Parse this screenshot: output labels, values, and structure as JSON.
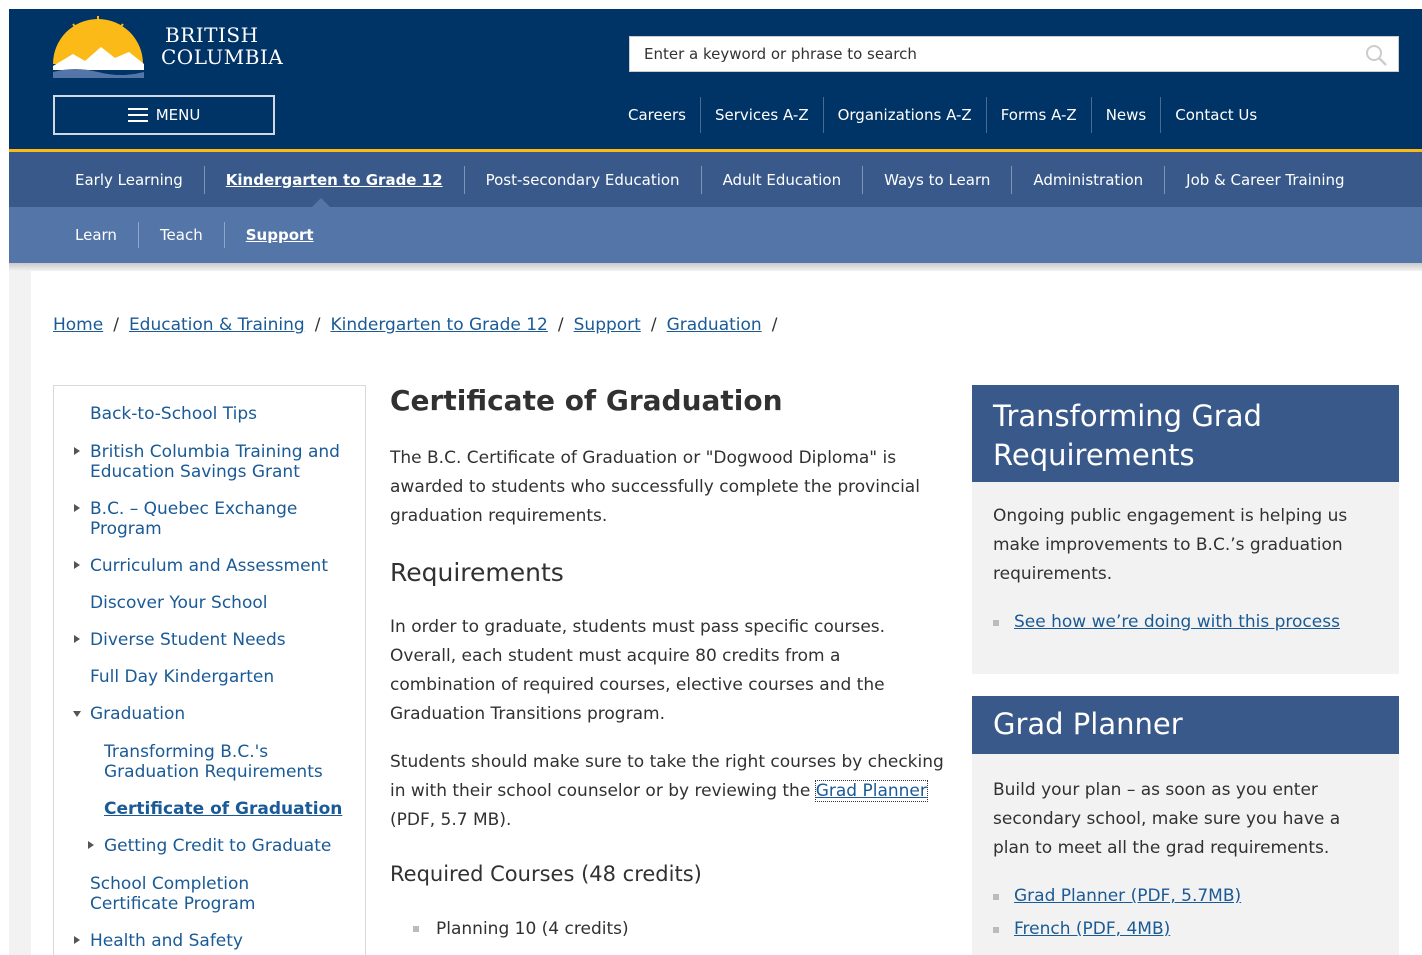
{
  "header": {
    "logo_line1": "BRITISH",
    "logo_line2": "COLUMBIA",
    "search_placeholder": "Enter a keyword or phrase to search",
    "menu_label": "MENU",
    "top_links": [
      "Careers",
      "Services A-Z",
      "Organizations A-Z",
      "Forms A-Z",
      "News",
      "Contact Us"
    ]
  },
  "nav_primary": [
    "Early Learning",
    "Kindergarten to Grade 12",
    "Post-secondary Education",
    "Adult Education",
    "Ways to Learn",
    "Administration",
    "Job & Career Training"
  ],
  "nav_primary_active": "Kindergarten to Grade 12",
  "nav_secondary": [
    "Learn",
    "Teach",
    "Support"
  ],
  "nav_secondary_active": "Support",
  "breadcrumb": [
    "Home",
    "Education & Training",
    "Kindergarten to Grade 12",
    "Support",
    "Graduation"
  ],
  "sidebar": {
    "items": [
      {
        "label": "Back-to-School Tips",
        "expandable": false
      },
      {
        "label": "British Columbia Training and Education Savings Grant",
        "expandable": true
      },
      {
        "label": "B.C. – Quebec Exchange Program",
        "expandable": true
      },
      {
        "label": "Curriculum and Assessment",
        "expandable": true
      },
      {
        "label": "Discover Your School",
        "expandable": false
      },
      {
        "label": "Diverse Student Needs",
        "expandable": true
      },
      {
        "label": "Full Day Kindergarten",
        "expandable": false
      },
      {
        "label": "Graduation",
        "expandable": true,
        "expanded": true
      },
      {
        "label": "Transforming B.C.'s Graduation Requirements",
        "sub": true
      },
      {
        "label": "Certificate of Graduation",
        "sub": true,
        "current": true
      },
      {
        "label": "Getting Credit to Graduate",
        "sub": true,
        "expandable": true
      },
      {
        "label": "School Completion Certificate Program",
        "expandable": false
      },
      {
        "label": "Health and Safety",
        "expandable": true
      }
    ]
  },
  "main": {
    "title": "Certificate of Graduation",
    "intro": "The B.C. Certificate of Graduation or \"Dogwood Diploma\" is awarded to students who successfully complete the provincial graduation requirements.",
    "requirements_heading": "Requirements",
    "requirements_text": "In order to graduate, students must pass specific courses. Overall, each student must acquire 80 credits from a combination of required courses, elective courses and the Graduation Transitions program.",
    "students_text_before": "Students should make sure to take the right courses by checking in with their school counselor or by reviewing the ",
    "grad_planner_link": "Grad Planner",
    "students_text_after": " (PDF, 5.7 MB).",
    "required_courses_heading": "Required Courses (48 credits)",
    "courses": [
      "Planning 10 (4 credits)"
    ]
  },
  "side_boxes": [
    {
      "title": "Transforming Grad Requirements",
      "body": "Ongoing public engagement is helping us make improvements to B.C.’s graduation requirements.",
      "links": [
        "See how we’re doing with this process"
      ]
    },
    {
      "title": "Grad Planner",
      "body": "Build your plan – as soon as you enter secondary school, make sure you have a plan to meet all the grad requirements.",
      "links": [
        "Grad Planner (PDF, 5.7MB)",
        "French (PDF, 4MB)"
      ]
    }
  ],
  "colors": {
    "header_bg": "#003366",
    "gold_accent": "#fcba19",
    "nav_primary_bg": "#38598a",
    "nav_secondary_bg": "#5475a7",
    "link": "#1a5a96"
  }
}
